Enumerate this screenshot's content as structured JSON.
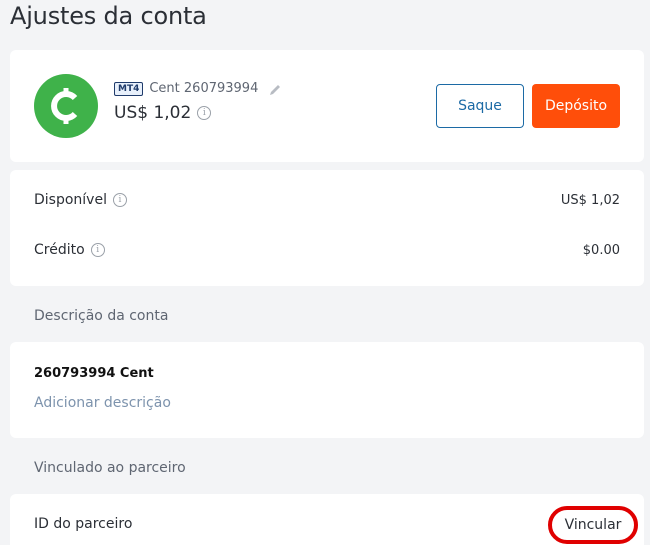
{
  "page": {
    "title": "Ajustes da conta"
  },
  "account": {
    "badge": "MT4",
    "name": "Cent 260793994",
    "balance": "US$ 1,02",
    "logo_color": "#3fb24a",
    "withdraw_label": "Saque",
    "deposit_label": "Depósito",
    "deposit_color": "#ff4e0a",
    "withdraw_color": "#1c6aa5"
  },
  "balances": {
    "available_label": "Disponível",
    "available_value": "US$ 1,02",
    "credit_label": "Crédito",
    "credit_value": "$0.00"
  },
  "description": {
    "section_label": "Descrição da conta",
    "title": "260793994 Cent",
    "add_link": "Adicionar descrição"
  },
  "partner": {
    "section_label": "Vinculado ao parceiro",
    "id_label": "ID do parceiro",
    "link_button": "Vincular",
    "highlight_color": "#e00000"
  },
  "icons": [
    "cent-logo-icon",
    "pencil-icon",
    "info-icon"
  ]
}
